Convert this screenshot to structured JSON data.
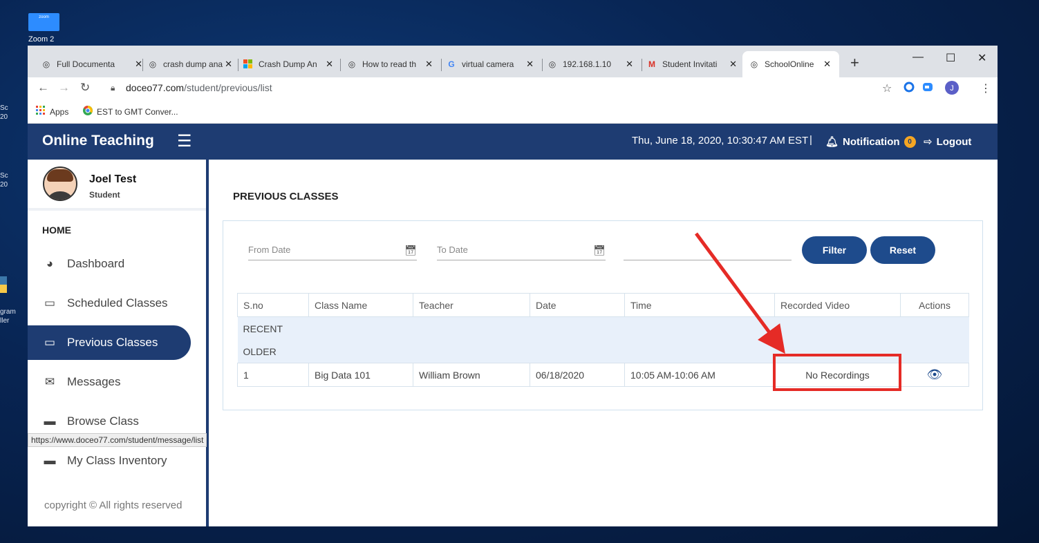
{
  "desktop": {
    "zoom_icon_text": "zoom",
    "zoom_label": "Zoom 2",
    "frag1": "Sc\n20",
    "frag2": "Sc\n20",
    "frag3": "gram\nller"
  },
  "browser": {
    "tabs": [
      {
        "label": "Full Documenta",
        "icon": "globe-icon"
      },
      {
        "label": "crash dump ana",
        "icon": "globe-icon"
      },
      {
        "label": "Crash Dump An",
        "icon": "windows-icon"
      },
      {
        "label": "How to read th",
        "icon": "globe-icon"
      },
      {
        "label": "virtual camera",
        "icon": "google-icon"
      },
      {
        "label": "192.168.1.10",
        "icon": "globe-icon"
      },
      {
        "label": "Student Invitati",
        "icon": "gmail-icon"
      },
      {
        "label": "SchoolOnline",
        "icon": "globe-icon"
      }
    ],
    "new_tab": "+",
    "url_domain": "doceo77.com",
    "url_path": "/student/previous/list",
    "bookmarks": [
      {
        "label": "Apps",
        "icon": "apps-grid-icon"
      },
      {
        "label": "EST to GMT Conver...",
        "icon": "chrome-icon"
      }
    ],
    "profile_initial": "J",
    "status_url": "https://www.doceo77.com/student/message/list"
  },
  "app": {
    "brand": "Online Teaching",
    "datetime": "Thu, June 18, 2020, 10:30:47 AM EST",
    "separator": "|",
    "notification_label": "Notification",
    "notification_count": "0",
    "logout_label": "Logout",
    "accent": "#1e3c72"
  },
  "sidebar": {
    "user_name": "Joel Test",
    "user_role": "Student",
    "section_label": "HOME",
    "items": [
      {
        "label": "Dashboard",
        "icon": "dashboard-icon"
      },
      {
        "label": "Scheduled Classes",
        "icon": "monitor-icon"
      },
      {
        "label": "Previous Classes",
        "icon": "monitor-icon",
        "active": true
      },
      {
        "label": "Messages",
        "icon": "envelope-icon"
      },
      {
        "label": "Browse Class",
        "icon": "window-icon"
      },
      {
        "label": "My Class Inventory",
        "icon": "window-icon"
      }
    ],
    "copyright": "copyright © All rights reserved"
  },
  "main": {
    "title": "PREVIOUS CLASSES",
    "filters": {
      "from_placeholder": "From Date",
      "to_placeholder": "To Date",
      "filter_label": "Filter",
      "reset_label": "Reset"
    },
    "table": {
      "headers": [
        "S.no",
        "Class Name",
        "Teacher",
        "Date",
        "Time",
        "Recorded Video",
        "Actions"
      ],
      "groups": [
        "RECENT",
        "OLDER"
      ],
      "rows": [
        {
          "sno": "1",
          "class_name": "Big Data 101",
          "teacher": "William Brown",
          "date": "06/18/2020",
          "time": "10:05 AM-10:06 AM",
          "recorded_video": "No Recordings",
          "action_icon": "eye-icon"
        }
      ]
    }
  }
}
